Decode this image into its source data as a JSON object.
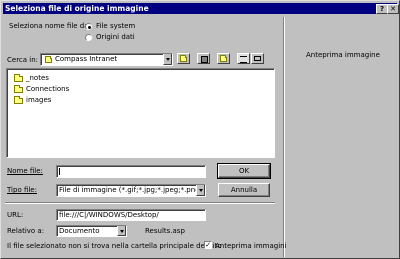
{
  "window": {
    "title": "Seleziona file di origine immagine",
    "help_glyph": "?",
    "close_glyph": "✕"
  },
  "source": {
    "label": "Seleziona nome file da:",
    "options": [
      {
        "label": "File system",
        "selected": true
      },
      {
        "label": "Origini dati",
        "selected": false
      }
    ]
  },
  "look_in": {
    "label": "Cerca in:",
    "value": "Compass Intranet"
  },
  "files": [
    {
      "name": "_notes"
    },
    {
      "name": "Connections"
    },
    {
      "name": "images"
    }
  ],
  "filename": {
    "label": "Nome file:",
    "value": ""
  },
  "filetype": {
    "label": "Tipo file:",
    "value": "File di immagine (*.gif;*.jpg;*.jpeg;*.png)"
  },
  "buttons": {
    "ok": "OK",
    "cancel": "Annulla"
  },
  "url": {
    "label": "URL:",
    "value": "file:///C|/WINDOWS/Desktop/"
  },
  "relative": {
    "label": "Relativo a:",
    "value": "Documento",
    "file": "Results.asp"
  },
  "warning": "Il file selezionato non si trova nella cartella principale del sito",
  "preview": {
    "title": "Anteprima immagine",
    "checkbox_label": "Anteprima immagini",
    "checked": true
  }
}
